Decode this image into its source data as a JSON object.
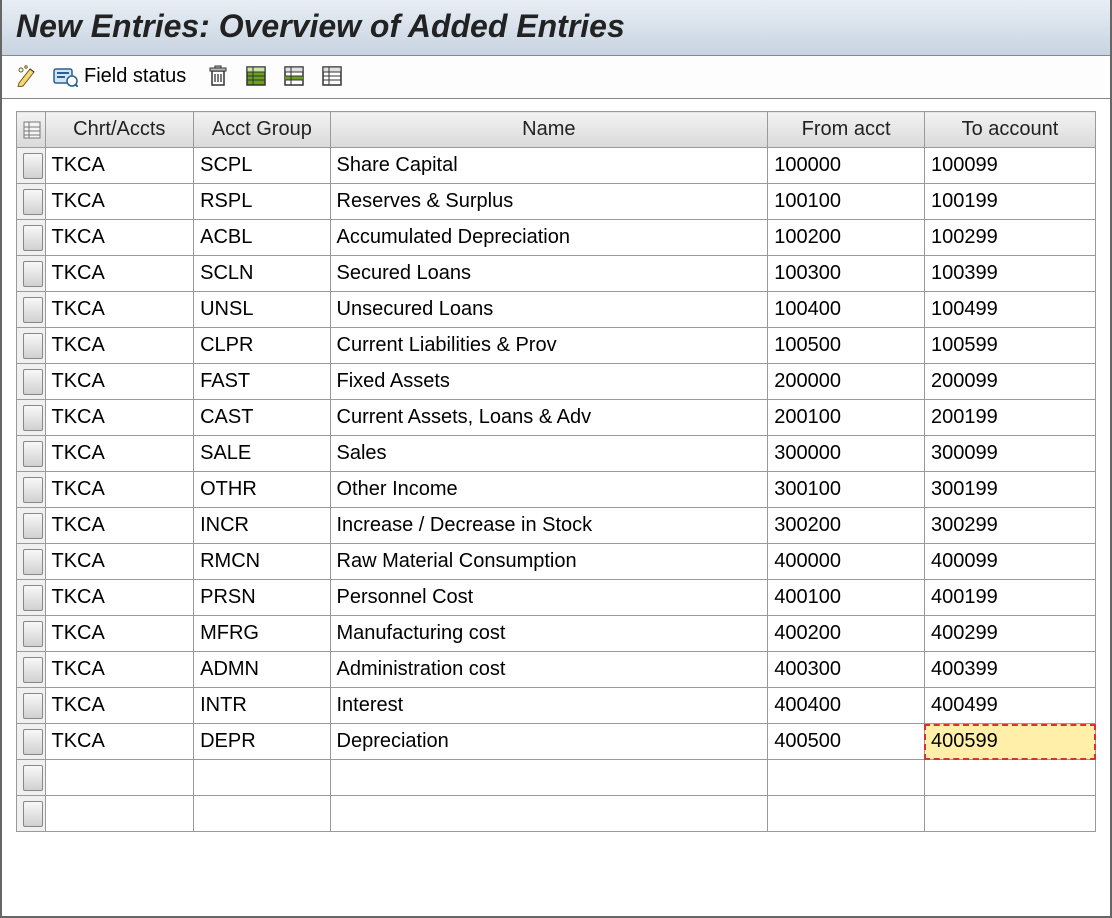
{
  "title": "New Entries: Overview of Added Entries",
  "toolbar": {
    "field_status_label": "Field status"
  },
  "columns": {
    "chrt": "Chrt/Accts",
    "grp": "Acct Group",
    "name": "Name",
    "from": "From acct",
    "to": "To account"
  },
  "rows": [
    {
      "chrt": "TKCA",
      "grp": "SCPL",
      "name": "Share Capital",
      "from": "100000",
      "to": "100099"
    },
    {
      "chrt": "TKCA",
      "grp": "RSPL",
      "name": "Reserves & Surplus",
      "from": "100100",
      "to": "100199"
    },
    {
      "chrt": "TKCA",
      "grp": "ACBL",
      "name": "Accumulated Depreciation",
      "from": "100200",
      "to": "100299"
    },
    {
      "chrt": "TKCA",
      "grp": "SCLN",
      "name": "Secured Loans",
      "from": "100300",
      "to": "100399"
    },
    {
      "chrt": "TKCA",
      "grp": "UNSL",
      "name": "Unsecured Loans",
      "from": "100400",
      "to": "100499"
    },
    {
      "chrt": "TKCA",
      "grp": "CLPR",
      "name": "Current Liabilities & Prov",
      "from": "100500",
      "to": "100599"
    },
    {
      "chrt": "TKCA",
      "grp": "FAST",
      "name": "Fixed Assets",
      "from": "200000",
      "to": "200099"
    },
    {
      "chrt": "TKCA",
      "grp": "CAST",
      "name": "Current Assets, Loans & Adv",
      "from": "200100",
      "to": "200199"
    },
    {
      "chrt": "TKCA",
      "grp": "SALE",
      "name": "Sales",
      "from": "300000",
      "to": "300099"
    },
    {
      "chrt": "TKCA",
      "grp": "OTHR",
      "name": "Other Income",
      "from": "300100",
      "to": "300199"
    },
    {
      "chrt": "TKCA",
      "grp": "INCR",
      "name": "Increase / Decrease in Stock",
      "from": "300200",
      "to": "300299"
    },
    {
      "chrt": "TKCA",
      "grp": "RMCN",
      "name": "Raw Material Consumption",
      "from": "400000",
      "to": "400099"
    },
    {
      "chrt": "TKCA",
      "grp": "PRSN",
      "name": "Personnel Cost",
      "from": "400100",
      "to": "400199"
    },
    {
      "chrt": "TKCA",
      "grp": "MFRG",
      "name": "Manufacturing cost",
      "from": "400200",
      "to": "400299"
    },
    {
      "chrt": "TKCA",
      "grp": "ADMN",
      "name": "Administration cost",
      "from": "400300",
      "to": "400399"
    },
    {
      "chrt": "TKCA",
      "grp": "INTR",
      "name": "Interest",
      "from": "400400",
      "to": "400499"
    },
    {
      "chrt": "TKCA",
      "grp": "DEPR",
      "name": "Depreciation",
      "from": "400500",
      "to": "400599"
    }
  ],
  "active_row_index": 16,
  "active_col": "to",
  "empty_trailing_rows": 2
}
